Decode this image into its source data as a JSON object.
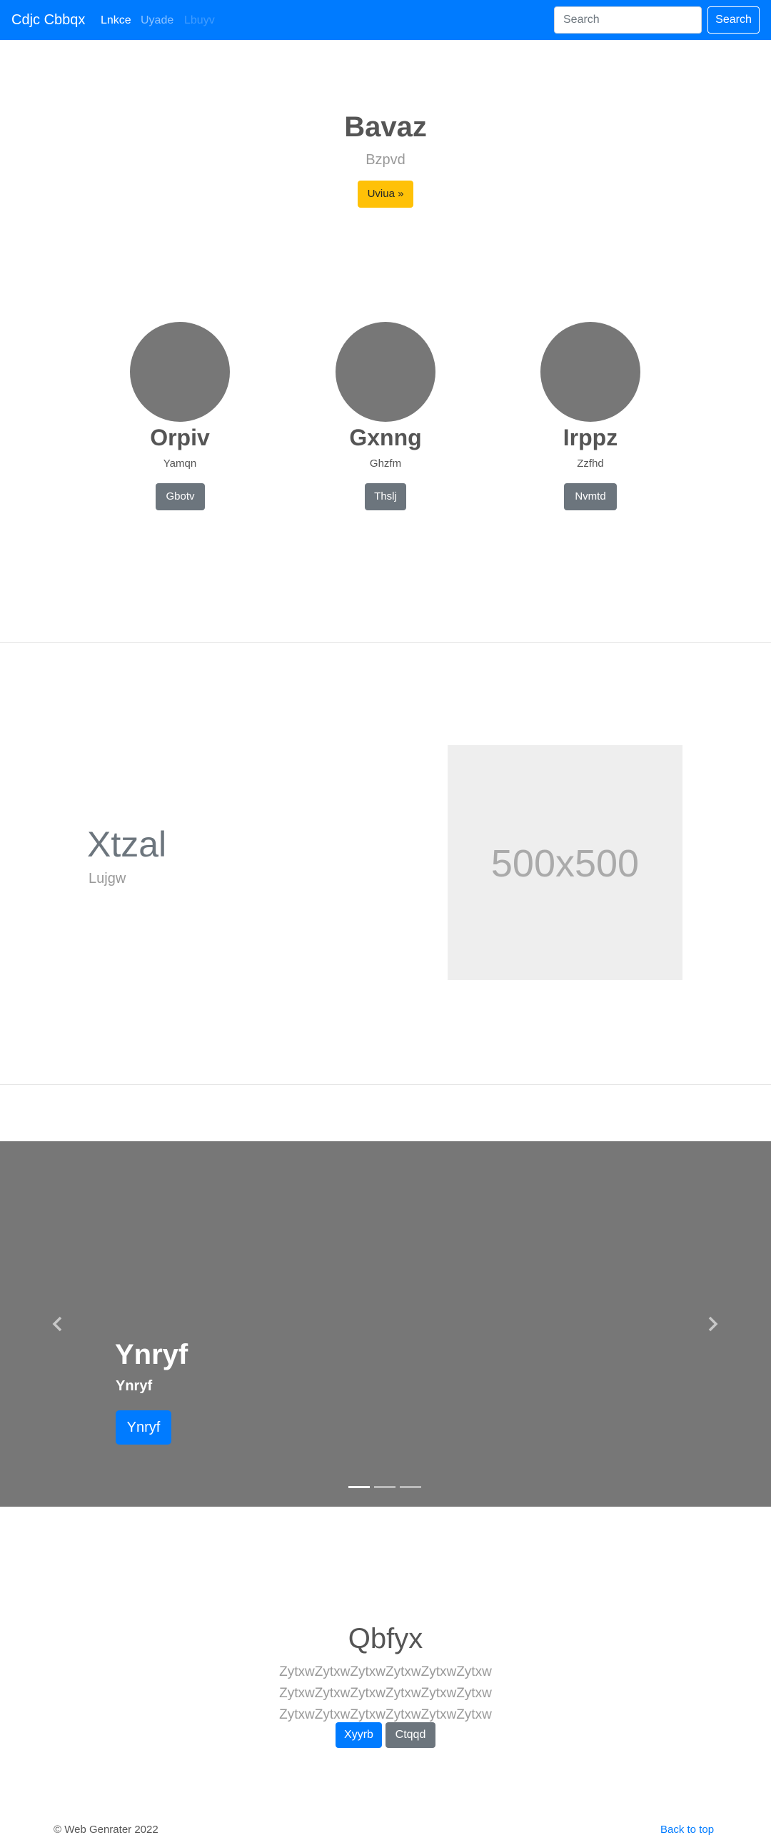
{
  "navbar": {
    "brand": "Cdjc Cbbqx",
    "links": [
      {
        "label": "Lnkce",
        "state": "active"
      },
      {
        "label": "Uyade",
        "state": "normal"
      },
      {
        "label": "Lbuyv",
        "state": "disabled"
      }
    ],
    "search_placeholder": "Search",
    "search_button": "Search"
  },
  "hero": {
    "title": "Bavaz",
    "subtitle": "Bzpvd",
    "button": "Uviua »"
  },
  "features": [
    {
      "name": "Orpiv",
      "text": "Yamqn",
      "button": "Gbotv"
    },
    {
      "name": "Gxnng",
      "text": "Ghzfm",
      "button": "Thslj"
    },
    {
      "name": "Irppz",
      "text": "Zzfhd",
      "button": "Nvmtd"
    }
  ],
  "featurette": {
    "heading": "Xtzal",
    "lead": "Lujgw",
    "image_label": "500x500"
  },
  "carousel": {
    "prev_icon": "chevron-left-icon",
    "next_icon": "chevron-right-icon",
    "title": "Ynryf",
    "text": "Ynryf",
    "button": "Ynryf",
    "active_slide": 1,
    "slide_count": 3
  },
  "cta": {
    "title": "Qbfyx",
    "lead": "ZytxwZytxwZytxwZytxwZytxwZytxw ZytxwZytxwZytxwZytxwZytxwZytxw ZytxwZytxwZytxwZytxwZytxwZytxw",
    "primary_button": "Xyyrb",
    "secondary_button": "Ctqqd"
  },
  "footer": {
    "copyright": "© Web Genrater 2022",
    "back_to_top": "Back to top"
  },
  "colors": {
    "primary": "#007bff",
    "warning": "#ffc107",
    "secondary": "#6c757d",
    "placeholder": "#777777"
  }
}
